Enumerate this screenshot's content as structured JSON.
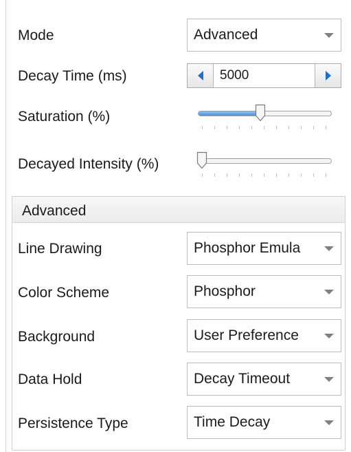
{
  "mode": {
    "label": "Mode",
    "value": "Advanced"
  },
  "decay_time": {
    "label": "Decay Time (ms)",
    "value": "5000"
  },
  "saturation": {
    "label": "Saturation (%)",
    "value_fraction": 0.47
  },
  "decayed_intensity": {
    "label": "Decayed Intensity (%)",
    "value_fraction": 0.0
  },
  "advanced": {
    "title": "Advanced",
    "line_drawing": {
      "label": "Line Drawing",
      "value": "Phosphor Emula"
    },
    "color_scheme": {
      "label": "Color Scheme",
      "value": "Phosphor"
    },
    "background": {
      "label": "Background",
      "value": "User Preference"
    },
    "data_hold": {
      "label": "Data Hold",
      "value": "Decay Timeout"
    },
    "persistence_type": {
      "label": "Persistence Type",
      "value": "Time Decay"
    }
  },
  "colors": {
    "accent": "#1f6fd0",
    "slider_fill": "#4a90d9"
  }
}
